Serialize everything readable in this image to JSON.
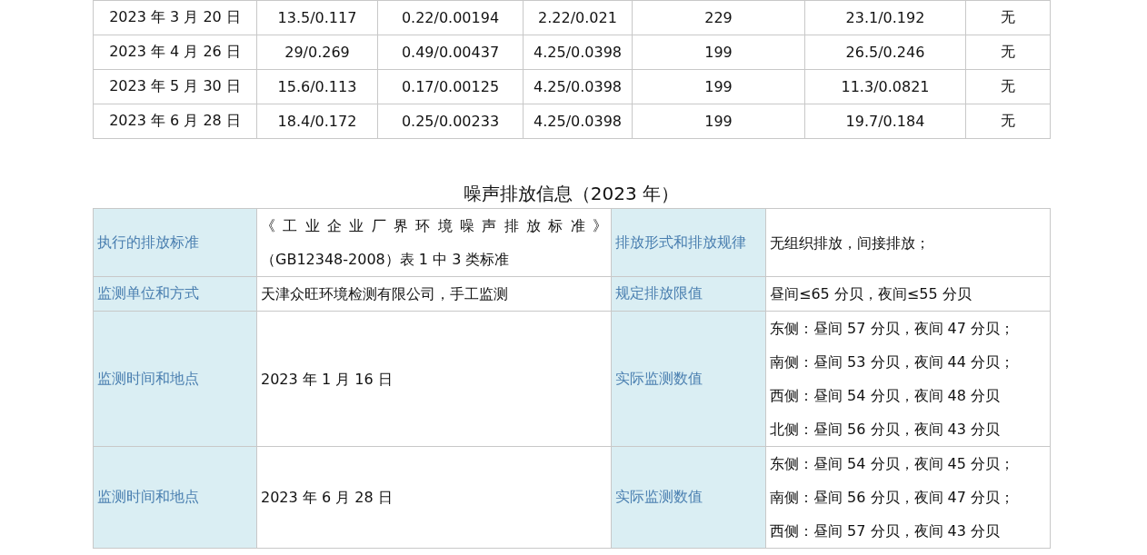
{
  "emission_table": {
    "rows": [
      [
        "2023 年 3 月 20 日",
        "13.5/0.117",
        "0.22/0.00194",
        "2.22/0.021",
        "229",
        "23.1/0.192",
        "无"
      ],
      [
        "2023 年 4 月 26 日",
        "29/0.269",
        "0.49/0.00437",
        "4.25/0.0398",
        "199",
        "26.5/0.246",
        "无"
      ],
      [
        "2023 年 5 月 30 日",
        "15.6/0.113",
        "0.17/0.00125",
        "4.25/0.0398",
        "199",
        "11.3/0.0821",
        "无"
      ],
      [
        "2023 年 6 月 28 日",
        "18.4/0.172",
        "0.25/0.00233",
        "4.25/0.0398",
        "199",
        "19.7/0.184",
        "无"
      ]
    ]
  },
  "noise_section": {
    "title": "噪声排放信息（2023 年）",
    "rows": [
      {
        "label_1": "执行的排放标准",
        "value_1": [
          "《工业企业厂界环境噪声排放标准》",
          "（GB12348-2008）表 1 中 3 类标准"
        ],
        "label_2": "排放形式和排放规律",
        "value_2": [
          "无组织排放，间接排放；"
        ]
      },
      {
        "label_1": "监测单位和方式",
        "value_1": [
          "天津众旺环境检测有限公司，手工监测"
        ],
        "label_2": "规定排放限值",
        "value_2": [
          "昼间≤65 分贝，夜间≤55 分贝"
        ]
      },
      {
        "label_1": "监测时间和地点",
        "value_1": [
          "2023 年 1 月 16 日"
        ],
        "label_2": "实际监测数值",
        "value_2": [
          "东侧：昼间 57 分贝，夜间 47 分贝；",
          "南侧：昼间 53 分贝，夜间 44 分贝；",
          "西侧：昼间 54 分贝，夜间 48 分贝",
          "北侧：昼间 56 分贝，夜间 43 分贝"
        ]
      },
      {
        "label_1": "监测时间和地点",
        "value_1": [
          "2023 年 6 月 28 日"
        ],
        "label_2": "实际监测数值",
        "value_2": [
          "东侧：昼间 54 分贝，夜间 45 分贝；",
          "南侧：昼间 56 分贝，夜间 47 分贝；",
          "西侧：昼间 57 分贝，夜间 43 分贝"
        ]
      }
    ]
  }
}
